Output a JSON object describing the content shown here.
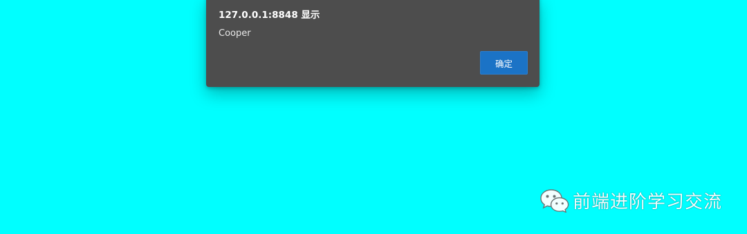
{
  "dialog": {
    "title": "127.0.0.1:8848 显示",
    "message": "Cooper",
    "ok_label": "确定"
  },
  "watermark": {
    "icon": "wechat-icon",
    "text": "前端进阶学习交流"
  },
  "colors": {
    "page_background": "#00ffff",
    "dialog_background": "#4d4d4d",
    "button_accent": "#1b73c6"
  }
}
